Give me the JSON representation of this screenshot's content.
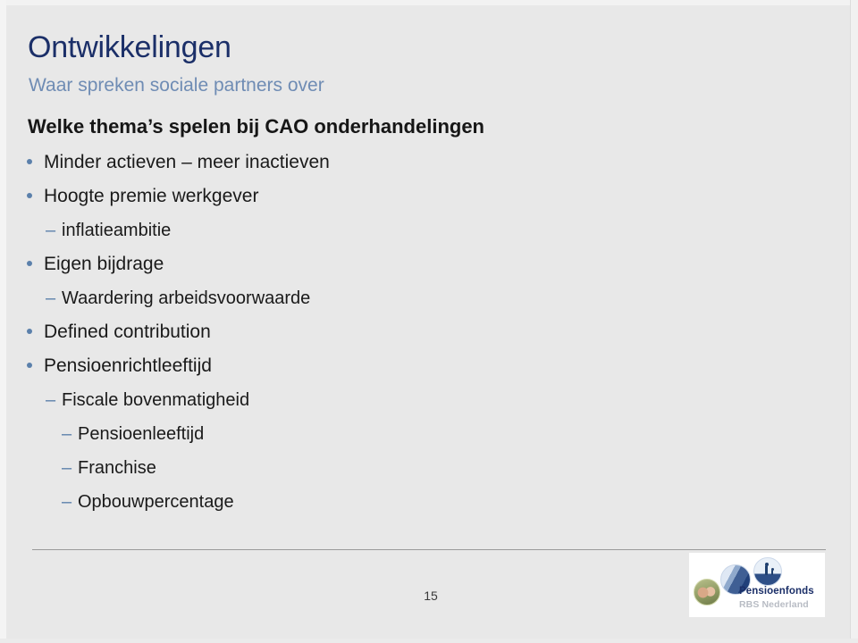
{
  "slide": {
    "title": "Ontwikkelingen",
    "subtitle": "Waar spreken sociale partners over",
    "lead": "Welke thema’s spelen bij CAO onderhandelingen",
    "bullets": [
      {
        "level": 1,
        "marker": "•",
        "text": "Minder actieven – meer inactieven"
      },
      {
        "level": 1,
        "marker": "•",
        "text": "Hoogte premie werkgever"
      },
      {
        "level": 2,
        "marker": "–",
        "text": "inflatieambitie"
      },
      {
        "level": 1,
        "marker": "•",
        "text": "Eigen bijdrage"
      },
      {
        "level": 2,
        "marker": "–",
        "text": "Waardering arbeidsvoorwaarde"
      },
      {
        "level": 1,
        "marker": "•",
        "text": "Defined contribution"
      },
      {
        "level": 1,
        "marker": "•",
        "text": "Pensioenrichtleeftijd"
      },
      {
        "level": 2,
        "marker": "–",
        "text": "Fiscale bovenmatigheid"
      },
      {
        "level": 3,
        "marker": "–",
        "text": "Pensioenleeftijd"
      },
      {
        "level": 3,
        "marker": "–",
        "text": "Franchise"
      },
      {
        "level": 3,
        "marker": "–",
        "text": "Opbouwpercentage"
      }
    ]
  },
  "footer": {
    "page_number": "15",
    "logo": {
      "name": "Pensioenfonds",
      "subtitle": "RBS Nederland",
      "badges": [
        "couple-photo-badge-icon",
        "blue-sail-building-badge-icon",
        "parent-child-silhouette-badge-icon"
      ]
    }
  },
  "colors": {
    "background": "#e8e8e8",
    "title": "#1b2f68",
    "subtitle": "#6f8cb4",
    "lead": "#161616",
    "bullet_marker": "#5b80ab",
    "body_text": "#1a1a1a",
    "footer_rule": "#9a9a9a",
    "page_number": "#3a3a3a",
    "logo_name": "#1b2f68",
    "logo_subtitle": "#b8bcc4"
  }
}
